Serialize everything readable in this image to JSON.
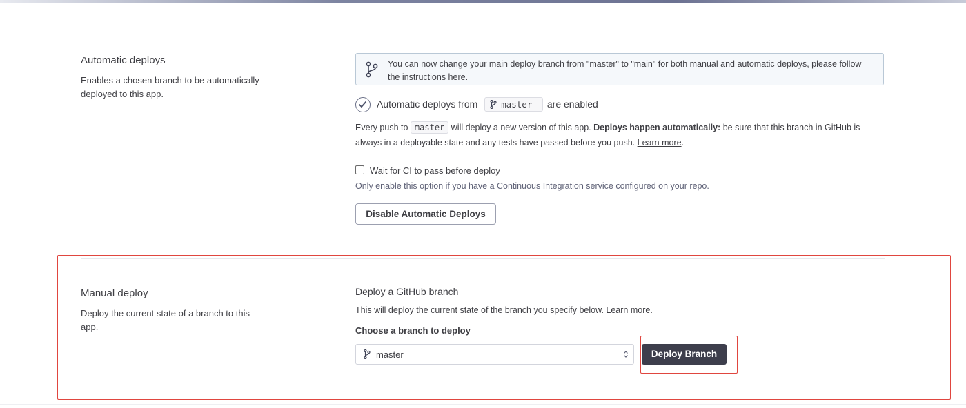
{
  "automatic_deploys": {
    "title": "Automatic deploys",
    "description": "Enables a chosen branch to be automatically deployed to this app.",
    "notice": {
      "text_before": "You can now change your main deploy branch from \"master\" to \"main\" for both manual and automatic deploys, please follow the instructions ",
      "link": "here",
      "text_after": ".",
      "icon": "git-branch-icon"
    },
    "status": {
      "prefix": "Automatic deploys from",
      "branch": "master",
      "suffix": "are enabled",
      "icon": "check-circle-icon"
    },
    "info": {
      "part1": "Every push to",
      "branch": "master",
      "part2": "will deploy a new version of this app.",
      "bold": "Deploys happen automatically:",
      "part3": "be sure that this branch in GitHub is always in a deployable state and any tests have passed before you push.",
      "link": "Learn more",
      "end": "."
    },
    "ci_checkbox": {
      "label": "Wait for CI to pass before deploy",
      "checked": false,
      "help": "Only enable this option if you have a Continuous Integration service configured on your repo."
    },
    "disable_button": "Disable Automatic Deploys"
  },
  "manual_deploy": {
    "title": "Manual deploy",
    "description": "Deploy the current state of a branch to this app.",
    "subtitle": "Deploy a GitHub branch",
    "info": "This will deploy the current state of the branch you specify below.",
    "info_link": "Learn more",
    "info_end": ".",
    "choose_label": "Choose a branch to deploy",
    "selected_branch": "master",
    "deploy_button": "Deploy Branch"
  },
  "colors": {
    "highlight": "#e0463f",
    "dark_button": "#3d3e4c",
    "notice_bg": "#f5f8fb"
  }
}
